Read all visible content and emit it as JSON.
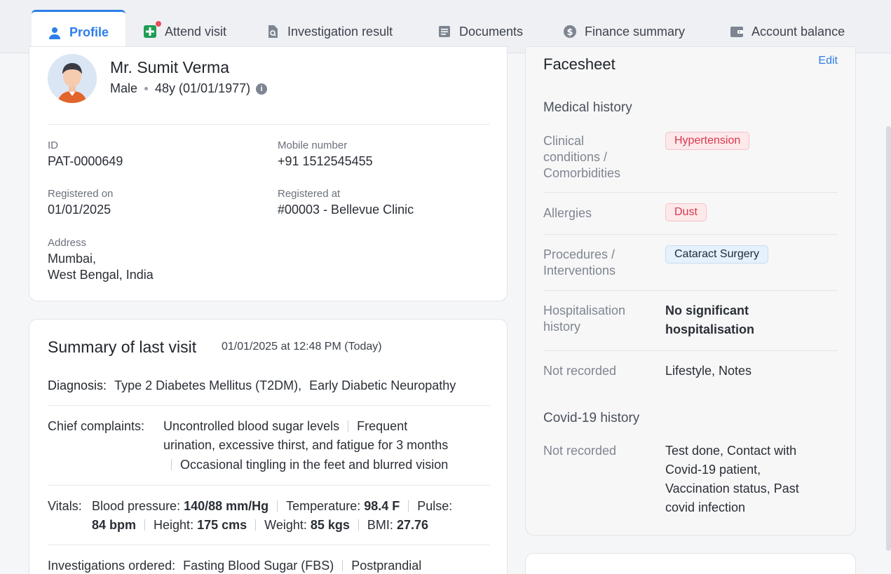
{
  "tabs": [
    {
      "label": "Profile",
      "icon": "person-icon",
      "active": true
    },
    {
      "label": "Attend visit",
      "icon": "medical-plus-icon"
    },
    {
      "label": "Investigation result",
      "icon": "search-document-icon"
    },
    {
      "label": "Documents",
      "icon": "document-icon"
    },
    {
      "label": "Finance summary",
      "icon": "dollar-coin-icon"
    },
    {
      "label": "Account balance",
      "icon": "wallet-icon"
    }
  ],
  "patient": {
    "name": "Mr. Sumit Verma",
    "gender": "Male",
    "age_dob": "48y (01/01/1977)",
    "fields": [
      {
        "label": "ID",
        "value": "PAT-0000649"
      },
      {
        "label": "Mobile number",
        "value": "+91 1512545455"
      },
      {
        "label": "Registered on",
        "value": "01/01/2025"
      },
      {
        "label": "Registered at",
        "value": "#00003 - Bellevue Clinic"
      }
    ],
    "address_label": "Address",
    "address_line1": "Mumbai,",
    "address_line2": "West Bengal, India"
  },
  "summary": {
    "title": "Summary of last visit",
    "date": "01/01/2025 at 12:48 PM (Today)",
    "diagnosis_label": "Diagnosis:",
    "diagnosis": [
      "Type 2 Diabetes Mellitus (T2DM),",
      "Early Diabetic Neuropathy"
    ],
    "complaints_label": "Chief complaints:",
    "complaint1": "Uncontrolled blood sugar levels",
    "complaint2a": "Frequent",
    "complaint2b": "urination, excessive thirst, and fatigue for 3 months",
    "complaint3": "Occasional tingling in the feet and blurred vision",
    "vitals_label": "Vitals:",
    "vitals": {
      "bp_label": "Blood pressure:",
      "bp": "140/88 mm/Hg",
      "temp_label": "Temperature:",
      "temp": "98.4 F",
      "pulse_label": "Pulse:",
      "pulse": "84 bpm",
      "height_label": "Height:",
      "height": "175 cms",
      "weight_label": "Weight:",
      "weight": "85 kgs",
      "bmi_label": "BMI:",
      "bmi": "27.76"
    },
    "investigations_label": "Investigations ordered:",
    "investigation1": "Fasting Blood Sugar (FBS)",
    "investigation2": "Postprandial"
  },
  "facesheet": {
    "title": "Facesheet",
    "edit": "Edit",
    "medical_history": "Medical history",
    "clinical_label_1": "Clinical",
    "clinical_label_2": "conditions /",
    "clinical_label_3": "Comorbidities",
    "clinical_value": "Hypertension",
    "allergies_label": "Allergies",
    "allergies_value": "Dust",
    "procedures_label_1": "Procedures /",
    "procedures_label_2": "Interventions",
    "procedures_value": "Cataract Surgery",
    "hosp_label_1": "Hospitalisation",
    "hosp_label_2": "history",
    "hosp_value_1": "No significant",
    "hosp_value_2": "hospitalisation",
    "not_recorded": "Not recorded",
    "not_recorded_value": "Lifestyle, Notes",
    "covid_history": "Covid-19 history",
    "covid_not_recorded": "Not recorded",
    "covid_value_1": "Test done, Contact with",
    "covid_value_2": "Covid-19 patient,",
    "covid_value_3": "Vaccination status, Past",
    "covid_value_4": "covid infection"
  }
}
